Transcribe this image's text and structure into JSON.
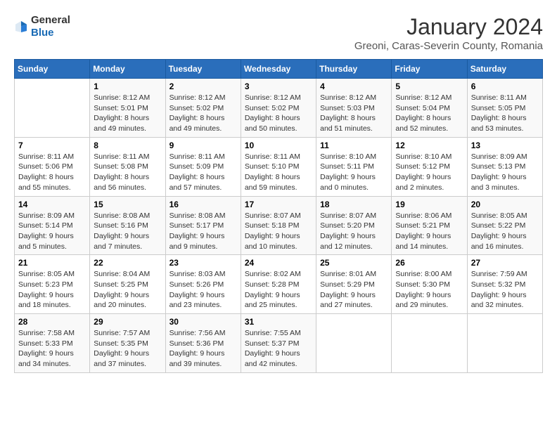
{
  "logo": {
    "text_general": "General",
    "text_blue": "Blue"
  },
  "title": "January 2024",
  "subtitle": "Greoni, Caras-Severin County, Romania",
  "columns": [
    "Sunday",
    "Monday",
    "Tuesday",
    "Wednesday",
    "Thursday",
    "Friday",
    "Saturday"
  ],
  "weeks": [
    [
      {
        "day": "",
        "sunrise": "",
        "sunset": "",
        "daylight": ""
      },
      {
        "day": "1",
        "sunrise": "Sunrise: 8:12 AM",
        "sunset": "Sunset: 5:01 PM",
        "daylight": "Daylight: 8 hours and 49 minutes."
      },
      {
        "day": "2",
        "sunrise": "Sunrise: 8:12 AM",
        "sunset": "Sunset: 5:02 PM",
        "daylight": "Daylight: 8 hours and 49 minutes."
      },
      {
        "day": "3",
        "sunrise": "Sunrise: 8:12 AM",
        "sunset": "Sunset: 5:02 PM",
        "daylight": "Daylight: 8 hours and 50 minutes."
      },
      {
        "day": "4",
        "sunrise": "Sunrise: 8:12 AM",
        "sunset": "Sunset: 5:03 PM",
        "daylight": "Daylight: 8 hours and 51 minutes."
      },
      {
        "day": "5",
        "sunrise": "Sunrise: 8:12 AM",
        "sunset": "Sunset: 5:04 PM",
        "daylight": "Daylight: 8 hours and 52 minutes."
      },
      {
        "day": "6",
        "sunrise": "Sunrise: 8:11 AM",
        "sunset": "Sunset: 5:05 PM",
        "daylight": "Daylight: 8 hours and 53 minutes."
      }
    ],
    [
      {
        "day": "7",
        "sunrise": "Sunrise: 8:11 AM",
        "sunset": "Sunset: 5:06 PM",
        "daylight": "Daylight: 8 hours and 55 minutes."
      },
      {
        "day": "8",
        "sunrise": "Sunrise: 8:11 AM",
        "sunset": "Sunset: 5:08 PM",
        "daylight": "Daylight: 8 hours and 56 minutes."
      },
      {
        "day": "9",
        "sunrise": "Sunrise: 8:11 AM",
        "sunset": "Sunset: 5:09 PM",
        "daylight": "Daylight: 8 hours and 57 minutes."
      },
      {
        "day": "10",
        "sunrise": "Sunrise: 8:11 AM",
        "sunset": "Sunset: 5:10 PM",
        "daylight": "Daylight: 8 hours and 59 minutes."
      },
      {
        "day": "11",
        "sunrise": "Sunrise: 8:10 AM",
        "sunset": "Sunset: 5:11 PM",
        "daylight": "Daylight: 9 hours and 0 minutes."
      },
      {
        "day": "12",
        "sunrise": "Sunrise: 8:10 AM",
        "sunset": "Sunset: 5:12 PM",
        "daylight": "Daylight: 9 hours and 2 minutes."
      },
      {
        "day": "13",
        "sunrise": "Sunrise: 8:09 AM",
        "sunset": "Sunset: 5:13 PM",
        "daylight": "Daylight: 9 hours and 3 minutes."
      }
    ],
    [
      {
        "day": "14",
        "sunrise": "Sunrise: 8:09 AM",
        "sunset": "Sunset: 5:14 PM",
        "daylight": "Daylight: 9 hours and 5 minutes."
      },
      {
        "day": "15",
        "sunrise": "Sunrise: 8:08 AM",
        "sunset": "Sunset: 5:16 PM",
        "daylight": "Daylight: 9 hours and 7 minutes."
      },
      {
        "day": "16",
        "sunrise": "Sunrise: 8:08 AM",
        "sunset": "Sunset: 5:17 PM",
        "daylight": "Daylight: 9 hours and 9 minutes."
      },
      {
        "day": "17",
        "sunrise": "Sunrise: 8:07 AM",
        "sunset": "Sunset: 5:18 PM",
        "daylight": "Daylight: 9 hours and 10 minutes."
      },
      {
        "day": "18",
        "sunrise": "Sunrise: 8:07 AM",
        "sunset": "Sunset: 5:20 PM",
        "daylight": "Daylight: 9 hours and 12 minutes."
      },
      {
        "day": "19",
        "sunrise": "Sunrise: 8:06 AM",
        "sunset": "Sunset: 5:21 PM",
        "daylight": "Daylight: 9 hours and 14 minutes."
      },
      {
        "day": "20",
        "sunrise": "Sunrise: 8:05 AM",
        "sunset": "Sunset: 5:22 PM",
        "daylight": "Daylight: 9 hours and 16 minutes."
      }
    ],
    [
      {
        "day": "21",
        "sunrise": "Sunrise: 8:05 AM",
        "sunset": "Sunset: 5:23 PM",
        "daylight": "Daylight: 9 hours and 18 minutes."
      },
      {
        "day": "22",
        "sunrise": "Sunrise: 8:04 AM",
        "sunset": "Sunset: 5:25 PM",
        "daylight": "Daylight: 9 hours and 20 minutes."
      },
      {
        "day": "23",
        "sunrise": "Sunrise: 8:03 AM",
        "sunset": "Sunset: 5:26 PM",
        "daylight": "Daylight: 9 hours and 23 minutes."
      },
      {
        "day": "24",
        "sunrise": "Sunrise: 8:02 AM",
        "sunset": "Sunset: 5:28 PM",
        "daylight": "Daylight: 9 hours and 25 minutes."
      },
      {
        "day": "25",
        "sunrise": "Sunrise: 8:01 AM",
        "sunset": "Sunset: 5:29 PM",
        "daylight": "Daylight: 9 hours and 27 minutes."
      },
      {
        "day": "26",
        "sunrise": "Sunrise: 8:00 AM",
        "sunset": "Sunset: 5:30 PM",
        "daylight": "Daylight: 9 hours and 29 minutes."
      },
      {
        "day": "27",
        "sunrise": "Sunrise: 7:59 AM",
        "sunset": "Sunset: 5:32 PM",
        "daylight": "Daylight: 9 hours and 32 minutes."
      }
    ],
    [
      {
        "day": "28",
        "sunrise": "Sunrise: 7:58 AM",
        "sunset": "Sunset: 5:33 PM",
        "daylight": "Daylight: 9 hours and 34 minutes."
      },
      {
        "day": "29",
        "sunrise": "Sunrise: 7:57 AM",
        "sunset": "Sunset: 5:35 PM",
        "daylight": "Daylight: 9 hours and 37 minutes."
      },
      {
        "day": "30",
        "sunrise": "Sunrise: 7:56 AM",
        "sunset": "Sunset: 5:36 PM",
        "daylight": "Daylight: 9 hours and 39 minutes."
      },
      {
        "day": "31",
        "sunrise": "Sunrise: 7:55 AM",
        "sunset": "Sunset: 5:37 PM",
        "daylight": "Daylight: 9 hours and 42 minutes."
      },
      {
        "day": "",
        "sunrise": "",
        "sunset": "",
        "daylight": ""
      },
      {
        "day": "",
        "sunrise": "",
        "sunset": "",
        "daylight": ""
      },
      {
        "day": "",
        "sunrise": "",
        "sunset": "",
        "daylight": ""
      }
    ]
  ]
}
